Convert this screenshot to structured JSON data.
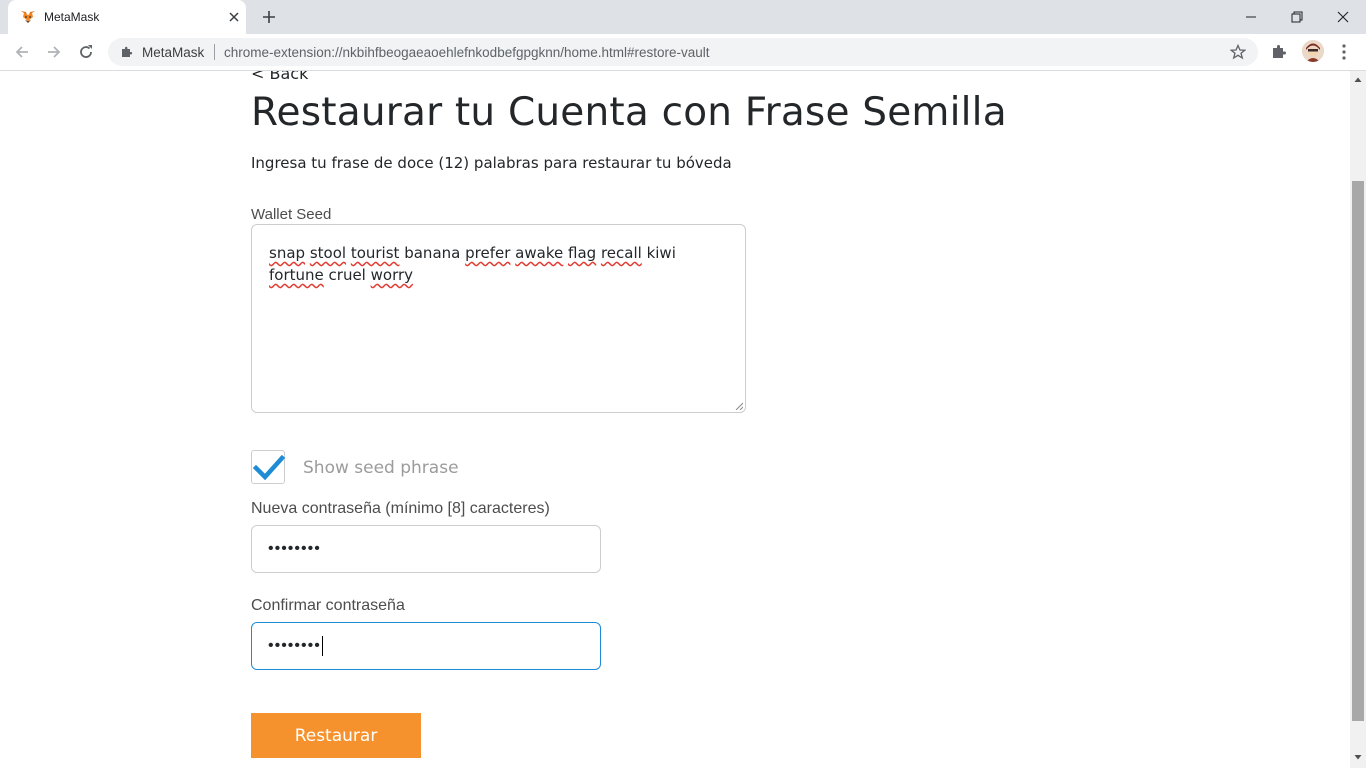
{
  "browser": {
    "tab_title": "MetaMask",
    "site_name": "MetaMask",
    "url": "chrome-extension://nkbihfbeogaeaoehlefnkodbefgpgknn/home.html#restore-vault"
  },
  "page": {
    "back_label": "< Back",
    "heading": "Restaurar tu Cuenta con Frase Semilla",
    "subtitle": "Ingresa tu frase de doce (12) palabras para restaurar tu bóveda",
    "seed_label": "Wallet Seed",
    "seed_words": [
      "snap",
      "stool",
      "tourist",
      "banana",
      "prefer",
      "awake",
      "flag",
      "recall",
      "kiwi",
      "fortune",
      "cruel",
      "worry"
    ],
    "show_seed_label": "Show seed phrase",
    "show_seed_checked": true,
    "password_label": "Nueva contraseña (mínimo [8] caracteres)",
    "password_value": "••••••••",
    "confirm_label": "Confirmar contraseña",
    "confirm_value": "••••••••",
    "restore_label": "Restaurar"
  },
  "colors": {
    "accent_orange": "#f6922d",
    "focus_blue": "#1d8bd5",
    "checkmark_blue": "#1d8bd5"
  },
  "icons": {
    "tab_favicon": "metamask-fox-icon",
    "site_icon": "puzzle-piece-icon"
  }
}
